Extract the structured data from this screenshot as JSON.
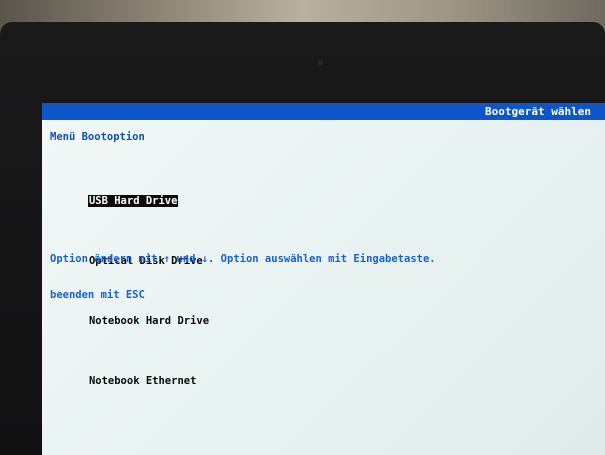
{
  "header": {
    "title": "Bootgerät wählen"
  },
  "menu": {
    "title": "Menü Bootoption",
    "options": [
      {
        "label": "USB Hard Drive",
        "selected": true
      },
      {
        "label": "Optical Disk Drive",
        "selected": false
      },
      {
        "label": "Notebook Hard Drive",
        "selected": false
      },
      {
        "label": "Notebook Ethernet",
        "selected": false
      }
    ]
  },
  "help": {
    "line1": "Option ändern mit ↑ und ↓. Option auswählen mit Eingabetaste.",
    "line2": "beenden mit ESC"
  },
  "colors": {
    "title_bar": "#0d55c9",
    "menu_title": "#1250b8",
    "help_text": "#1660d8",
    "selection_background": "#0a0a0a",
    "screen_background": "#eaf3f2"
  }
}
